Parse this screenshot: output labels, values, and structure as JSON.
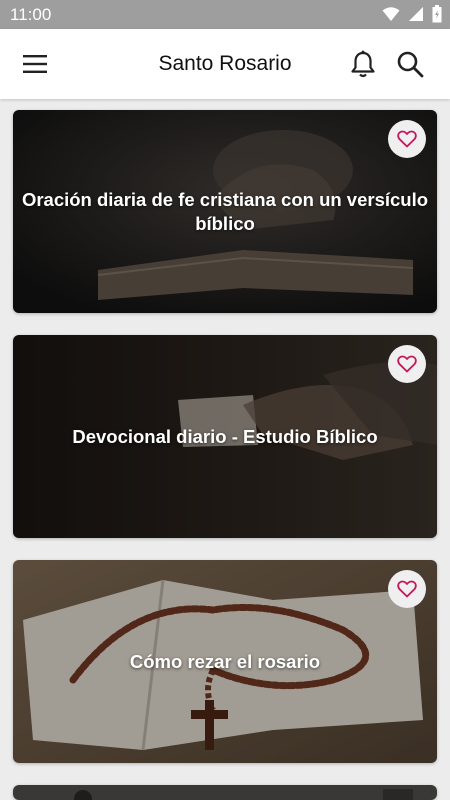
{
  "status_bar": {
    "time": "11:00",
    "icons": [
      "wifi-icon",
      "signal-icon",
      "battery-icon"
    ]
  },
  "app_bar": {
    "title": "Santo Rosario",
    "icons": [
      "menu-icon",
      "bell-icon",
      "search-icon"
    ]
  },
  "cards": [
    {
      "title": "Oración diaria de fe cristiana con un versículo bíblico",
      "favorite_icon": "heart-outline-icon"
    },
    {
      "title": "Devocional diario - Estudio Bíblico",
      "favorite_icon": "heart-outline-icon"
    },
    {
      "title": "Cómo rezar el rosario",
      "favorite_icon": "heart-outline-icon"
    }
  ],
  "colors": {
    "accent": "#c2185b",
    "status_bar": "#9e9e9e",
    "app_bar": "#ffffff",
    "background": "#ececec"
  }
}
